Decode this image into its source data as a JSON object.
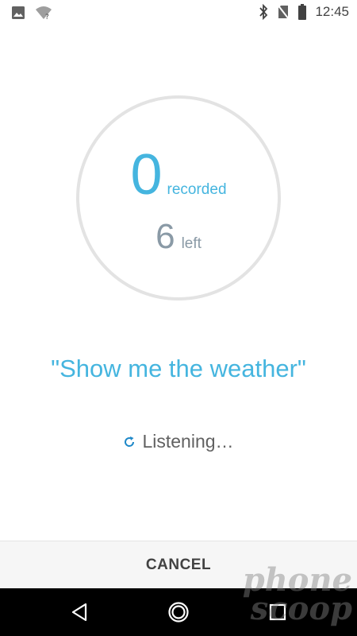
{
  "status_bar": {
    "time": "12:45",
    "icons": [
      "image-notification-icon",
      "wifi-unknown-icon",
      "bluetooth-icon",
      "no-sim-icon",
      "battery-icon"
    ]
  },
  "progress": {
    "recorded_count": "0",
    "recorded_label": "recorded",
    "left_count": "6",
    "left_label": "left"
  },
  "phrase": "\"Show me the weather\"",
  "status": {
    "text": "Listening…",
    "icon": "refresh-icon"
  },
  "actions": {
    "cancel_label": "CANCEL"
  },
  "nav_bar": {
    "icons": [
      "back-icon",
      "home-icon",
      "recents-icon"
    ]
  },
  "watermark": {
    "line1": "phone",
    "line2": "scoop"
  },
  "colors": {
    "accent": "#45b5df",
    "muted": "#8a9aa6",
    "ring": "#e3e3e3"
  }
}
